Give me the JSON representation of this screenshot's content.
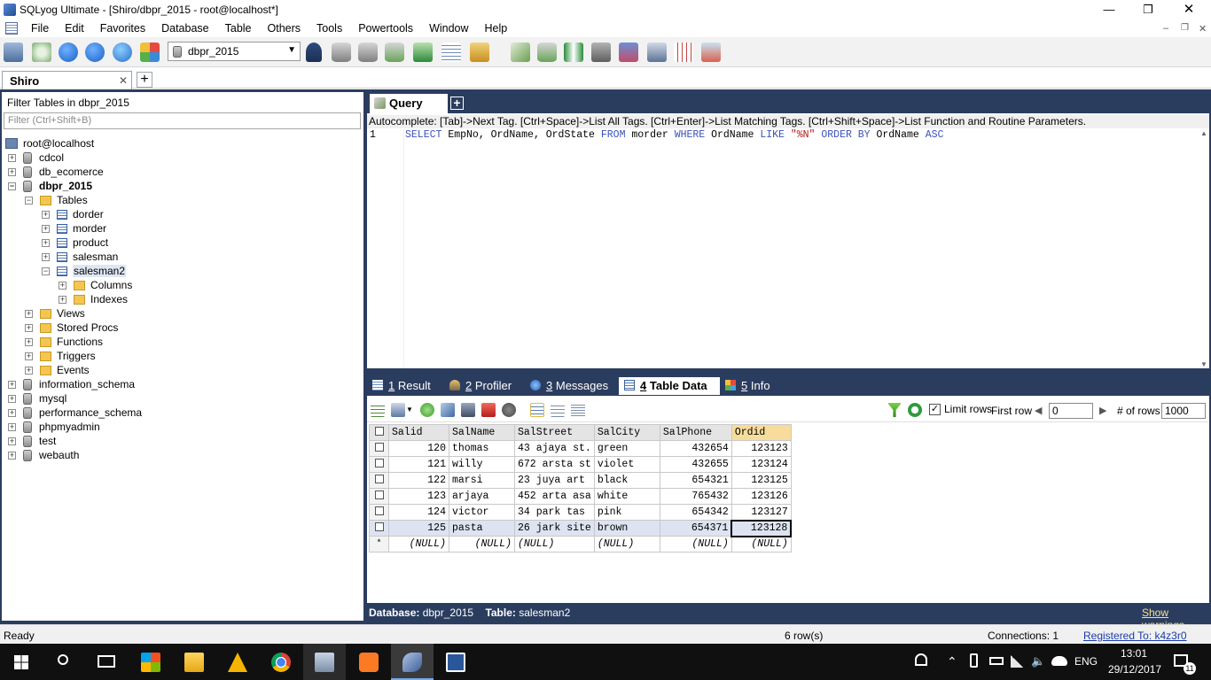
{
  "window": {
    "title": "SQLyog Ultimate - [Shiro/dbpr_2015 - root@localhost*]",
    "controls": [
      "—",
      "❐",
      "✕"
    ],
    "mdi_controls": [
      "–",
      "❐",
      "✕"
    ]
  },
  "menu": [
    "File",
    "Edit",
    "Favorites",
    "Database",
    "Table",
    "Others",
    "Tools",
    "Powertools",
    "Window",
    "Help"
  ],
  "toolbar": {
    "db_selector_value": "dbpr_2015"
  },
  "connection_tab": {
    "label": "Shiro",
    "close": "✕",
    "add": "+"
  },
  "object_browser": {
    "filter_label": "Filter Tables in dbpr_2015",
    "filter_placeholder": "Filter (Ctrl+Shift+B)",
    "root": "root@localhost",
    "databases": {
      "cdcol": "cdcol",
      "db_ecomerce": "db_ecomerce",
      "dbpr_2015": "dbpr_2015",
      "information_schema": "information_schema",
      "mysql": "mysql",
      "performance_schema": "performance_schema",
      "phpmyadmin": "phpmyadmin",
      "test": "test",
      "webauth": "webauth"
    },
    "folders": {
      "tables": "Tables",
      "columns": "Columns",
      "indexes": "Indexes",
      "views": "Views",
      "stored_procs": "Stored Procs",
      "functions": "Functions",
      "triggers": "Triggers",
      "events": "Events"
    },
    "tables": {
      "dorder": "dorder",
      "morder": "morder",
      "product": "product",
      "salesman": "salesman",
      "salesman2": "salesman2"
    }
  },
  "query": {
    "tab_label": "Query",
    "autocomplete_hint": "Autocomplete: [Tab]->Next Tag. [Ctrl+Space]->List All Tags. [Ctrl+Enter]->List Matching Tags. [Ctrl+Shift+Space]->List Function and Routine Parameters.",
    "line_number": "1",
    "sql": {
      "select": "SELECT",
      "columns": " EmpNo, OrdName, OrdState ",
      "from": "FROM",
      "table": " morder ",
      "where": "WHERE",
      "col": " OrdName ",
      "like": "LIKE",
      "pattern": " \"%N\" ",
      "order_by": "ORDER BY",
      "order_col": " OrdName ",
      "asc": "ASC"
    }
  },
  "result_tabs": [
    {
      "num": "1",
      "label": "Result"
    },
    {
      "num": "2",
      "label": "Profiler"
    },
    {
      "num": "3",
      "label": "Messages"
    },
    {
      "num": "4",
      "label": "Table Data"
    },
    {
      "num": "5",
      "label": "Info"
    }
  ],
  "result_toolbar": {
    "limit_rows_label": "Limit rows",
    "limit_rows_checked": "✓",
    "first_row_label": "First row",
    "first_row_value": "0",
    "num_rows_label": "# of rows",
    "num_rows_value": "1000",
    "prev": "◀",
    "next": "▶"
  },
  "grid": {
    "columns": [
      "Salid",
      "SalName",
      "SalStreet",
      "SalCity",
      "SalPhone",
      "Ordid"
    ],
    "rows": [
      [
        "120",
        "thomas",
        "43 ajaya st.",
        "green",
        "432654",
        "123123"
      ],
      [
        "121",
        "willy",
        "672 arsta st",
        "violet",
        "432655",
        "123124"
      ],
      [
        "122",
        "marsi",
        "23 juya art",
        "black",
        "654321",
        "123125"
      ],
      [
        "123",
        "arjaya",
        "452 arta asa",
        "white",
        "765432",
        "123126"
      ],
      [
        "124",
        "victor",
        "34 park tas",
        "pink",
        "654342",
        "123127"
      ],
      [
        "125",
        "pasta",
        "26 jark site",
        "brown",
        "654371",
        "123128"
      ]
    ],
    "new_row_marker": "*",
    "null_text": "(NULL)"
  },
  "info_bar": {
    "db_label": "Database:",
    "db_value": "dbpr_2015",
    "table_label": "Table:",
    "table_value": "salesman2",
    "show_warnings": "Show warnings"
  },
  "status_bar": {
    "left": "Ready",
    "rows": "6 row(s)",
    "connections": "Connections: 1",
    "registered": "Registered To: k4z3r0"
  },
  "taskbar": {
    "lang": "ENG",
    "time": "13:01",
    "date": "29/12/2017",
    "notif_count": "11"
  }
}
